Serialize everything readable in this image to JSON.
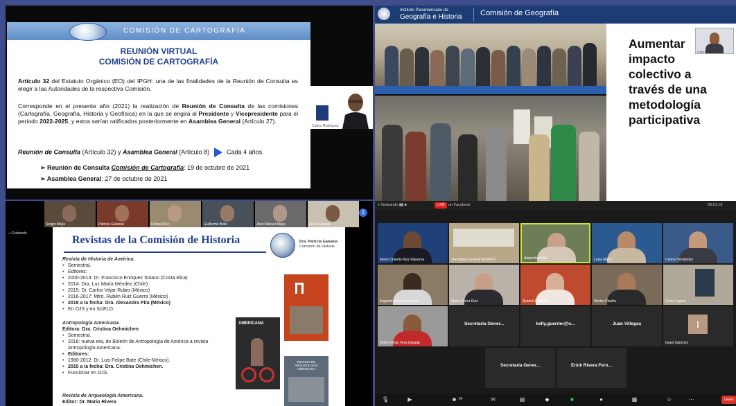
{
  "carto": {
    "banner": "COMISIÓN DE CARTOGRAFÍA",
    "title1": "REUNIÓN VIRTUAL",
    "title2": "COMISIÓN DE CARTOGRAFÍA",
    "para1_b": "Artículo 32",
    "para1": " del Estatuto Orgánico (EO) del IPGH: una de las finalidades de la Reunión de Consulta es elegir a las Autoridades de la respectiva Comisión.",
    "para2_a": "Corresponde en el presente año (2021) la realización de ",
    "para2_b1": "Reunión de Consulta",
    "para2_c": " de las comisiones (Cartografía, Geografía, Historia y Geofísica) en la que se erigirá al ",
    "para2_b2": "Presidente",
    "para2_d": " y ",
    "para2_b3": "Vicepresidente",
    "para2_e": " para el periodo ",
    "para2_b4": "2022-2025",
    "para2_f": ", y estos serían ratificados posteriormente en ",
    "para2_b5": "Asamblea General",
    "para2_g": " (Artículo 27).",
    "line3_a": "Reunión de Consulta",
    "line3_b": " (Artículo 32) y ",
    "line3_c": "Asamblea General",
    "line3_d": " (Artículo 8)",
    "line3_e": "Cada 4  años.",
    "bullet1_a": "Reunión de Consulta ",
    "bullet1_b": "Comisión de Cartografía",
    "bullet1_c": ":  19 de octubre de 2021",
    "bullet2_a": "Asamblea General",
    "bullet2_b": ": 27 de octubre de 2021",
    "cam_name": "Carlos Rodríguez"
  },
  "geo": {
    "org_line1": "Instituto Panamericano de",
    "org_line2": "Geografía e Historia",
    "commission": "Comisión de Geografía",
    "slogan": [
      "Aumentar",
      "impacto",
      "colectivo a",
      "través de una",
      "metodología",
      "participativa"
    ],
    "mini_name": "Luisa Mayo"
  },
  "hist": {
    "rec": "Grabando",
    "thumbs": [
      "Sergio Mejía",
      "Patricia Galeana",
      "Rafael Ruiz",
      "Guillermo Boils",
      "José Manuel Maya",
      "Jesús Rangel"
    ],
    "more": "1",
    "title": "Revistas de la Comisión de Historia",
    "who1": "Dra. Patricia Galeana",
    "who2": "Comisión de Historia",
    "block1_head": "Revista de Historia de América.",
    "block1": [
      "Semestral.",
      "Editores:",
      "2000-2013: Dr. Francisco Enriquez Solano (Costa Rica)",
      "2014: Dra. Luz María Méndez (Chile)",
      "2015: Dr. Carlos Véjar-Rubio (México)",
      "2016-2017: Mtro. Rubén Ruiz Guerra (México)",
      "2018 a la fecha: Dra. Alexandra Pita (México)",
      "En OJS y en SciELO."
    ],
    "block2_head": "Antropología Americana.",
    "block2_editor": "Editora: Dra. Cristina Oehmichen",
    "block2": [
      "Semestral.",
      "2016: nueva era, de Boletín de Antropología de América a revista Antropología Americana.",
      "Editores:",
      "1980-2012: Dr. Luis Felipe Bate (Chile-México).",
      "2015 a la fecha: Dra. Cristina Oehmichen.",
      "Funcionar en OJS."
    ],
    "block3_head": "Revista de Arqueología Americana.",
    "block3_editor": "Editor: Dr. Mario Rivera",
    "cover2_label": "AMERICANA",
    "cover3_label": "REVISTA DE ARQUEOLOGÍA AMERICANA"
  },
  "zoom": {
    "bar_left": "Grabando",
    "live": "LIVE",
    "live_on": "on Facebook",
    "bar_right": "00:51:16",
    "tiles": [
      {
        "name": "Mario Orlando Ruiz Figueroa",
        "center": ""
      },
      {
        "name": "Secretaría General del IPGH",
        "center": ""
      },
      {
        "name": "Alejandra Ortiz",
        "center": ""
      },
      {
        "name": "Luisa Mayo",
        "center": ""
      },
      {
        "name": "Carlos Hernández",
        "center": ""
      },
      {
        "name": "Eugenio Rolando Pinaña",
        "center": ""
      },
      {
        "name": "Mario Ferrer Ruiz",
        "center": ""
      },
      {
        "name": "Ayamel Palacios",
        "center": ""
      },
      {
        "name": "Héctor Pinaña",
        "center": ""
      },
      {
        "name": "Denis Legros",
        "center": ""
      },
      {
        "name": "Kelvin Omar Vera Quijada",
        "center": ""
      },
      {
        "name": "",
        "center": "Secretaría Gener..."
      },
      {
        "name": "",
        "center": "kelly.guerrier@o..."
      },
      {
        "name": "",
        "center": "Juan Villegas"
      },
      {
        "name": "Israel Sánchez",
        "center": "I"
      },
      {
        "name": "",
        "center": "Secretaría Gener..."
      },
      {
        "name": "",
        "center": "Erick Rivera Fern..."
      }
    ],
    "participants": "54",
    "end": "Leave"
  }
}
